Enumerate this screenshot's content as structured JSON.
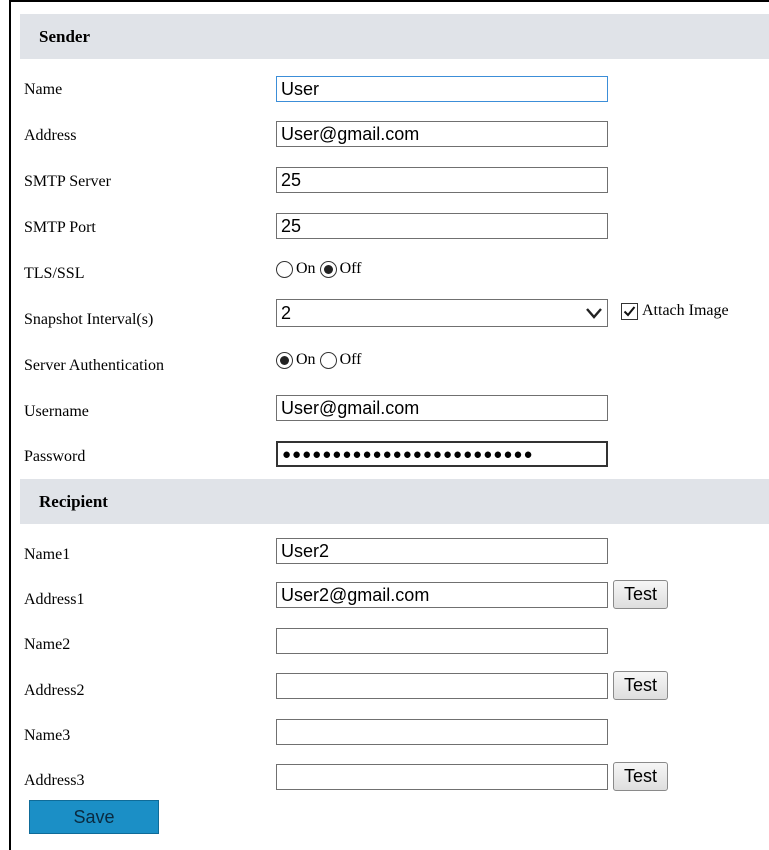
{
  "sender": {
    "header": "Sender",
    "name_label": "Name",
    "name_value": "User",
    "address_label": "Address",
    "address_value": "User@gmail.com",
    "smtp_server_label": "SMTP Server",
    "smtp_server_value": "25",
    "smtp_port_label": "SMTP Port",
    "smtp_port_value": "25",
    "tls_label": "TLS/SSL",
    "tls_on_label": "On",
    "tls_off_label": "Off",
    "tls_selected": "Off",
    "snapshot_label": "Snapshot Interval(s)",
    "snapshot_value": "2",
    "attach_image_label": "Attach Image",
    "attach_image_checked": true,
    "auth_label": "Server Authentication",
    "auth_on_label": "On",
    "auth_off_label": "Off",
    "auth_selected": "On",
    "username_label": "Username",
    "username_value": "User@gmail.com",
    "password_label": "Password",
    "password_masked": "●●●●●●●●●●●●●●●●●●●●●●●●●"
  },
  "recipient": {
    "header": "Recipient",
    "name1_label": "Name1",
    "name1_value": "User2",
    "address1_label": "Address1",
    "address1_value": "User2@gmail.com",
    "name2_label": "Name2",
    "name2_value": "",
    "address2_label": "Address2",
    "address2_value": "",
    "name3_label": "Name3",
    "name3_value": "",
    "address3_label": "Address3",
    "address3_value": "",
    "test_label": "Test"
  },
  "save_label": "Save",
  "colors": {
    "header_bg": "#e0e3e8",
    "save_button": "#1b8fc6",
    "focus_border": "#3c8ed8"
  }
}
